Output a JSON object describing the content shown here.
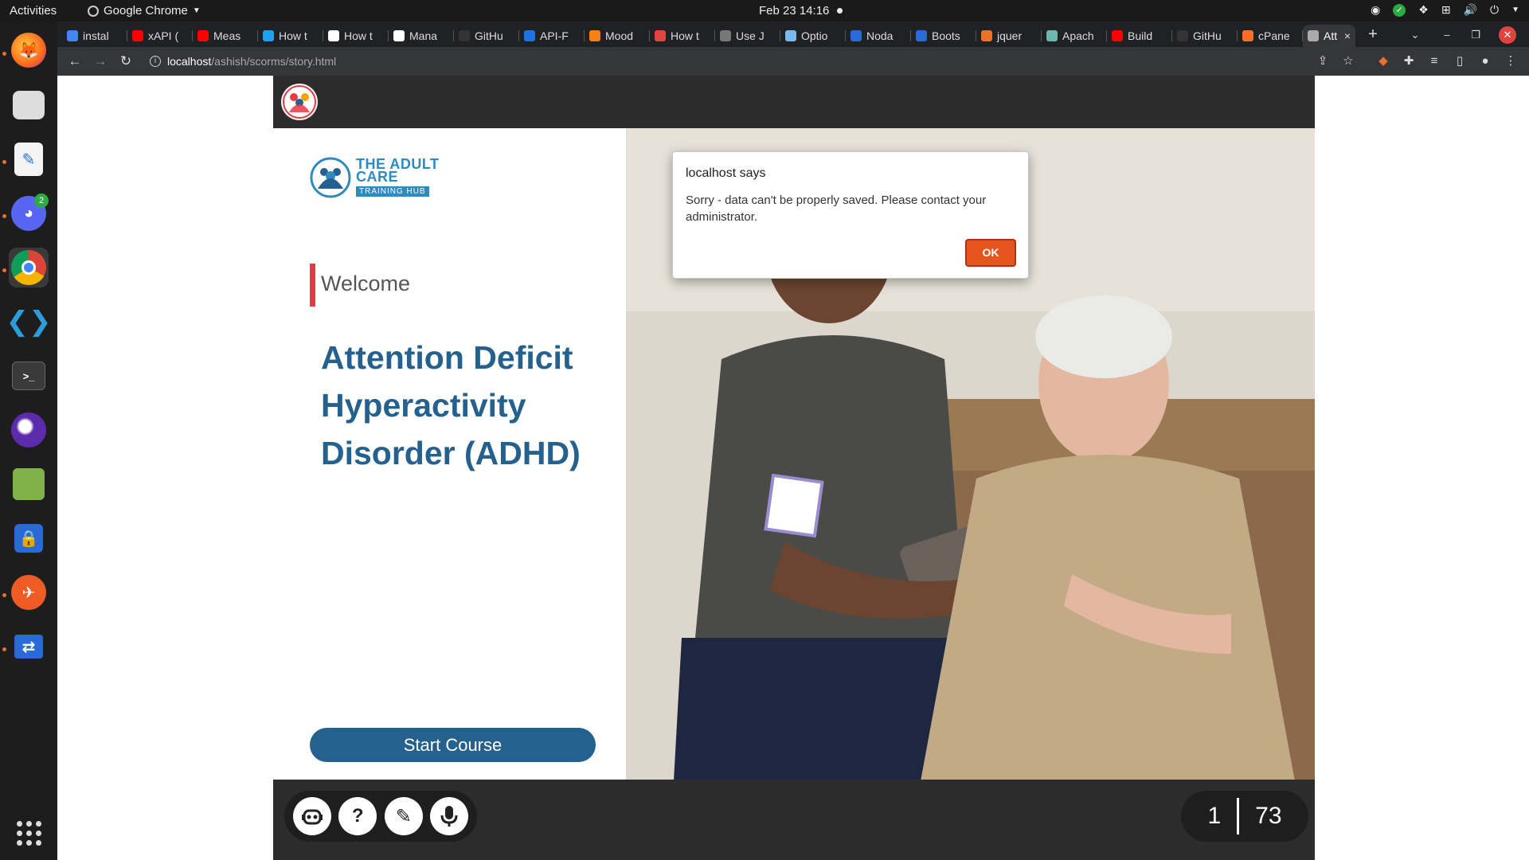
{
  "topbar": {
    "activities": "Activities",
    "app_name": "Google Chrome",
    "datetime": "Feb 23  14:16"
  },
  "dock": {
    "discord_badge": "2"
  },
  "tabs": [
    {
      "label": "instal",
      "color": "#4285f4"
    },
    {
      "label": "xAPI (",
      "color": "#ff0000"
    },
    {
      "label": "Meas",
      "color": "#ff0000"
    },
    {
      "label": "How t",
      "color": "#1da1f2"
    },
    {
      "label": "How t",
      "color": "#ffffff"
    },
    {
      "label": "Mana",
      "color": "#ffffff"
    },
    {
      "label": "GitHu",
      "color": "#333333"
    },
    {
      "label": "API-F",
      "color": "#1a73e8"
    },
    {
      "label": "Mood",
      "color": "#f98012"
    },
    {
      "label": "How t",
      "color": "#e0443e"
    },
    {
      "label": "Use J",
      "color": "#777777"
    },
    {
      "label": "Optio",
      "color": "#7ab8f0"
    },
    {
      "label": "Noda",
      "color": "#2a6ad8"
    },
    {
      "label": "Boots",
      "color": "#2a6ad8"
    },
    {
      "label": "jquer",
      "color": "#e8722c"
    },
    {
      "label": "Apach",
      "color": "#6cb6b0"
    },
    {
      "label": "Build",
      "color": "#ff0000"
    },
    {
      "label": "GitHu",
      "color": "#333333"
    },
    {
      "label": "cPane",
      "color": "#ff6c2c"
    },
    {
      "label": "Att",
      "color": "#aaaaaa"
    }
  ],
  "address_bar": {
    "host": "localhost",
    "path": "/ashish/scorms/story.html"
  },
  "slide": {
    "brand_line1": "THE ADULT",
    "brand_line2": "CARE",
    "brand_line3": "TRAINING HUB",
    "welcome": "Welcome",
    "title": "Attention Deficit Hyperactivity Disorder (ADHD)",
    "start_button": "Start Course"
  },
  "pager": {
    "current": "1",
    "total": "73"
  },
  "alert": {
    "title": "localhost says",
    "message": "Sorry - data can't be properly saved. Please contact your administrator.",
    "ok_label": "OK"
  },
  "colors": {
    "accent_blue": "#24618f",
    "brand_blue": "#2e8bc0",
    "welcome_bar": "#e63946",
    "ok_button": "#e8541e"
  }
}
